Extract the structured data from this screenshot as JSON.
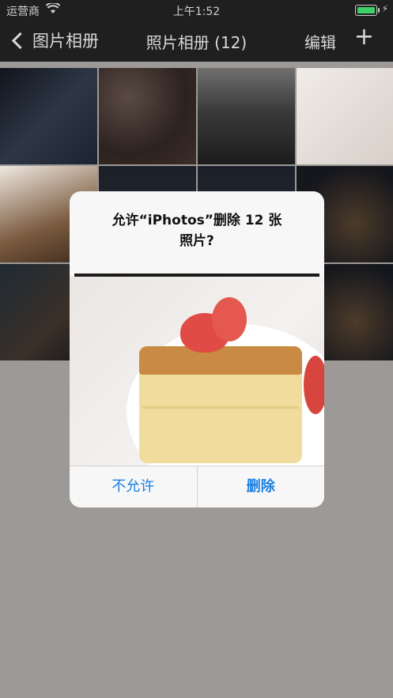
{
  "status": {
    "carrier": "运营商",
    "time": "上午1:52",
    "wifi_icon": "wifi-icon",
    "battery_icon": "battery-icon"
  },
  "nav": {
    "back_label": "图片相册",
    "title": "照片相册 (12)",
    "edit_label": "编辑",
    "add_label": "+"
  },
  "alert": {
    "title_line1": "允许“iPhotos”删除 12 张",
    "title_line2": "照片?",
    "cancel_label": "不允许",
    "confirm_label": "删除"
  },
  "colors": {
    "accent": "#1a7fe0",
    "navbar": "#1f1f1f",
    "backdrop": "#9c9996",
    "battery": "#3fd06a"
  }
}
